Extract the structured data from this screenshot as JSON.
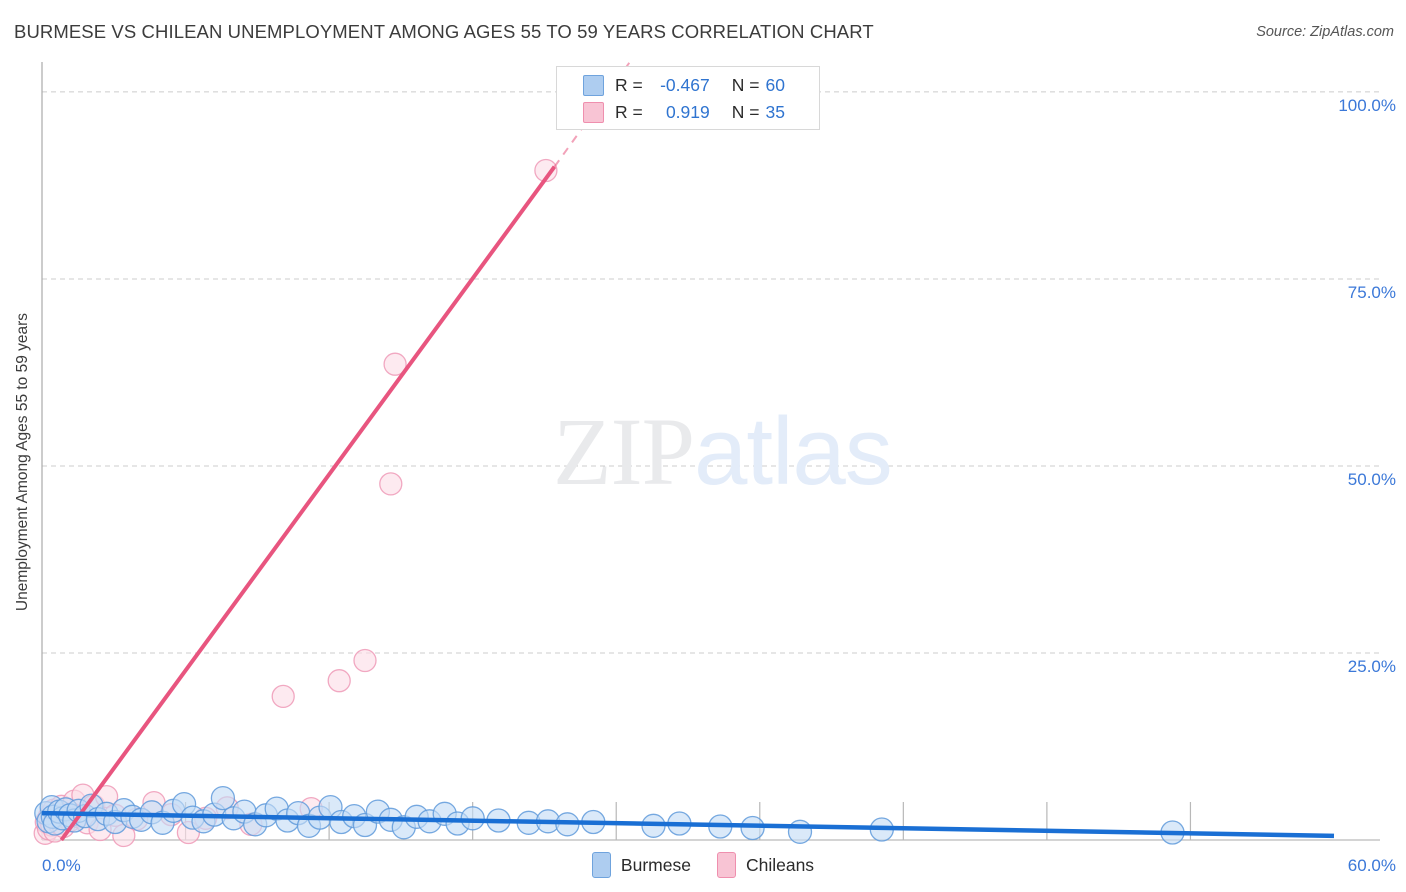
{
  "header": {
    "title": "BURMESE VS CHILEAN UNEMPLOYMENT AMONG AGES 55 TO 59 YEARS CORRELATION CHART",
    "source": "Source: ZipAtlas.com"
  },
  "watermark": {
    "part1": "ZIP",
    "part2": "atlas"
  },
  "stats_legend": {
    "rows": [
      {
        "series": "Burmese",
        "r_label": "R =",
        "r_value": "-0.467",
        "n_label": "N =",
        "n_value": "60",
        "color": "#aecdf0"
      },
      {
        "series": "Chileans",
        "r_label": "R =",
        "r_value": "0.919",
        "n_label": "N =",
        "n_value": "35",
        "color": "#f8c4d4"
      }
    ]
  },
  "bottom_legend": {
    "items": [
      {
        "label": "Burmese",
        "color": "#aecdf0"
      },
      {
        "label": "Chileans",
        "color": "#f8c4d4"
      }
    ]
  },
  "chart_data": {
    "type": "scatter",
    "title": "BURMESE VS CHILEAN UNEMPLOYMENT AMONG AGES 55 TO 59 YEARS CORRELATION CHART",
    "xlabel": "",
    "ylabel": "Unemployment Among Ages 55 to 59 years",
    "xlim": [
      0,
      60
    ],
    "ylim": [
      0,
      104
    ],
    "grid": true,
    "legend_position": "bottom-center",
    "x_ticks": [
      "0.0%",
      "60.0%"
    ],
    "x_tick_values": [
      0,
      60
    ],
    "y_ticks": [
      "25.0%",
      "50.0%",
      "75.0%",
      "100.0%"
    ],
    "y_tick_values": [
      25,
      50,
      75,
      100
    ],
    "colors": {
      "burmese_fill": "#c3dbf5",
      "burmese_stroke": "#5f9ada",
      "burmese_line": "#1a6fd4",
      "chilean_fill": "#fbdde6",
      "chilean_stroke": "#ef9ab7",
      "chilean_line": "#e8557f",
      "tick_label": "#3b78d8",
      "title": "#3c3c3c"
    },
    "series": [
      {
        "name": "Burmese",
        "r": -0.467,
        "n": 60,
        "trendline": {
          "x0": 0,
          "y0": 3.6,
          "x1": 60,
          "y1": 0.55
        },
        "points": [
          [
            0.2,
            3.6
          ],
          [
            0.3,
            2.5
          ],
          [
            0.45,
            4.4
          ],
          [
            0.5,
            3.1
          ],
          [
            0.6,
            2.2
          ],
          [
            0.8,
            3.8
          ],
          [
            0.95,
            2.9
          ],
          [
            1.1,
            4.1
          ],
          [
            1.3,
            3.3
          ],
          [
            1.5,
            2.6
          ],
          [
            1.7,
            3.9
          ],
          [
            2.0,
            3.2
          ],
          [
            2.3,
            4.6
          ],
          [
            2.6,
            2.8
          ],
          [
            3.0,
            3.5
          ],
          [
            3.4,
            2.4
          ],
          [
            3.8,
            4.0
          ],
          [
            4.2,
            3.1
          ],
          [
            4.6,
            2.7
          ],
          [
            5.1,
            3.7
          ],
          [
            5.6,
            2.3
          ],
          [
            6.1,
            3.9
          ],
          [
            6.6,
            4.8
          ],
          [
            7.0,
            3.0
          ],
          [
            7.5,
            2.5
          ],
          [
            8.0,
            3.4
          ],
          [
            8.4,
            5.6
          ],
          [
            8.9,
            2.9
          ],
          [
            9.4,
            3.8
          ],
          [
            9.9,
            2.1
          ],
          [
            10.4,
            3.3
          ],
          [
            10.9,
            4.2
          ],
          [
            11.4,
            2.6
          ],
          [
            11.9,
            3.6
          ],
          [
            12.4,
            1.9
          ],
          [
            12.9,
            3.0
          ],
          [
            13.4,
            4.4
          ],
          [
            13.9,
            2.4
          ],
          [
            14.5,
            3.2
          ],
          [
            15.0,
            2.0
          ],
          [
            15.6,
            3.8
          ],
          [
            16.2,
            2.7
          ],
          [
            16.8,
            1.7
          ],
          [
            17.4,
            3.1
          ],
          [
            18.0,
            2.5
          ],
          [
            18.7,
            3.5
          ],
          [
            19.3,
            2.2
          ],
          [
            20.0,
            2.9
          ],
          [
            21.2,
            2.6
          ],
          [
            22.6,
            2.3
          ],
          [
            23.5,
            2.5
          ],
          [
            24.4,
            2.1
          ],
          [
            25.6,
            2.4
          ],
          [
            28.4,
            1.9
          ],
          [
            29.6,
            2.2
          ],
          [
            31.5,
            1.8
          ],
          [
            33.0,
            1.6
          ],
          [
            35.2,
            1.1
          ],
          [
            39.0,
            1.4
          ],
          [
            52.5,
            1.0
          ]
        ]
      },
      {
        "name": "Chileans",
        "r": 0.919,
        "n": 35,
        "trendline": {
          "x0": 0.9,
          "y0": 0,
          "x1": 23.8,
          "y1": 90
        },
        "trendline_dashed": {
          "x0": 23.8,
          "y0": 90,
          "x1": 27.3,
          "y1": 104
        },
        "points": [
          [
            0.15,
            0.9
          ],
          [
            0.2,
            2.4
          ],
          [
            0.3,
            1.5
          ],
          [
            0.35,
            3.2
          ],
          [
            0.45,
            2.0
          ],
          [
            0.55,
            4.0
          ],
          [
            0.6,
            1.2
          ],
          [
            0.7,
            3.0
          ],
          [
            0.8,
            2.2
          ],
          [
            0.9,
            4.5
          ],
          [
            1.0,
            1.8
          ],
          [
            1.15,
            3.5
          ],
          [
            1.3,
            2.6
          ],
          [
            1.5,
            5.2
          ],
          [
            1.7,
            3.1
          ],
          [
            1.9,
            6.0
          ],
          [
            2.1,
            2.3
          ],
          [
            2.4,
            4.6
          ],
          [
            2.7,
            1.4
          ],
          [
            3.0,
            5.8
          ],
          [
            3.4,
            3.3
          ],
          [
            3.8,
            0.6
          ],
          [
            4.4,
            2.8
          ],
          [
            5.2,
            5.0
          ],
          [
            6.0,
            3.4
          ],
          [
            6.8,
            1.0
          ],
          [
            7.6,
            2.9
          ],
          [
            8.6,
            4.3
          ],
          [
            9.7,
            2.1
          ],
          [
            11.2,
            19.2
          ],
          [
            12.5,
            4.2
          ],
          [
            13.8,
            21.3
          ],
          [
            15.0,
            24.0
          ],
          [
            16.2,
            47.6
          ],
          [
            16.4,
            63.6
          ],
          [
            23.4,
            89.5
          ]
        ]
      }
    ]
  }
}
